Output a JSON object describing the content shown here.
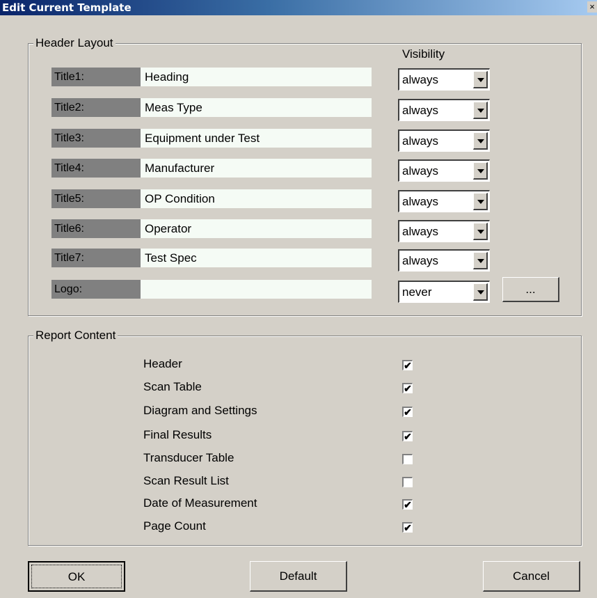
{
  "window": {
    "title": "Edit Current Template",
    "close_glyph": "×"
  },
  "header_layout": {
    "legend": "Header Layout",
    "visibility_label": "Visibility",
    "rows": [
      {
        "label": "Title1:",
        "value": "Heading",
        "visibility": "always"
      },
      {
        "label": "Title2:",
        "value": "Meas Type",
        "visibility": "always"
      },
      {
        "label": "Title3:",
        "value": "Equipment under Test",
        "visibility": "always"
      },
      {
        "label": "Title4:",
        "value": "Manufacturer",
        "visibility": "always"
      },
      {
        "label": "Title5:",
        "value": "OP Condition",
        "visibility": "always"
      },
      {
        "label": "Title6:",
        "value": "Operator",
        "visibility": "always"
      },
      {
        "label": "Title7:",
        "value": "Test Spec",
        "visibility": "always"
      },
      {
        "label": "Logo:",
        "value": "",
        "visibility": "never"
      }
    ],
    "browse_label": "..."
  },
  "report_content": {
    "legend": "Report Content",
    "items": [
      {
        "label": "Header",
        "checked": true
      },
      {
        "label": "Scan Table",
        "checked": true
      },
      {
        "label": "Diagram and Settings",
        "checked": true
      },
      {
        "label": "Final Results",
        "checked": true
      },
      {
        "label": "Transducer Table",
        "checked": false
      },
      {
        "label": "Scan Result List",
        "checked": false
      },
      {
        "label": "Date of Measurement",
        "checked": true
      },
      {
        "label": "Page Count",
        "checked": true
      }
    ]
  },
  "buttons": {
    "ok": "OK",
    "default": "Default",
    "cancel": "Cancel"
  }
}
